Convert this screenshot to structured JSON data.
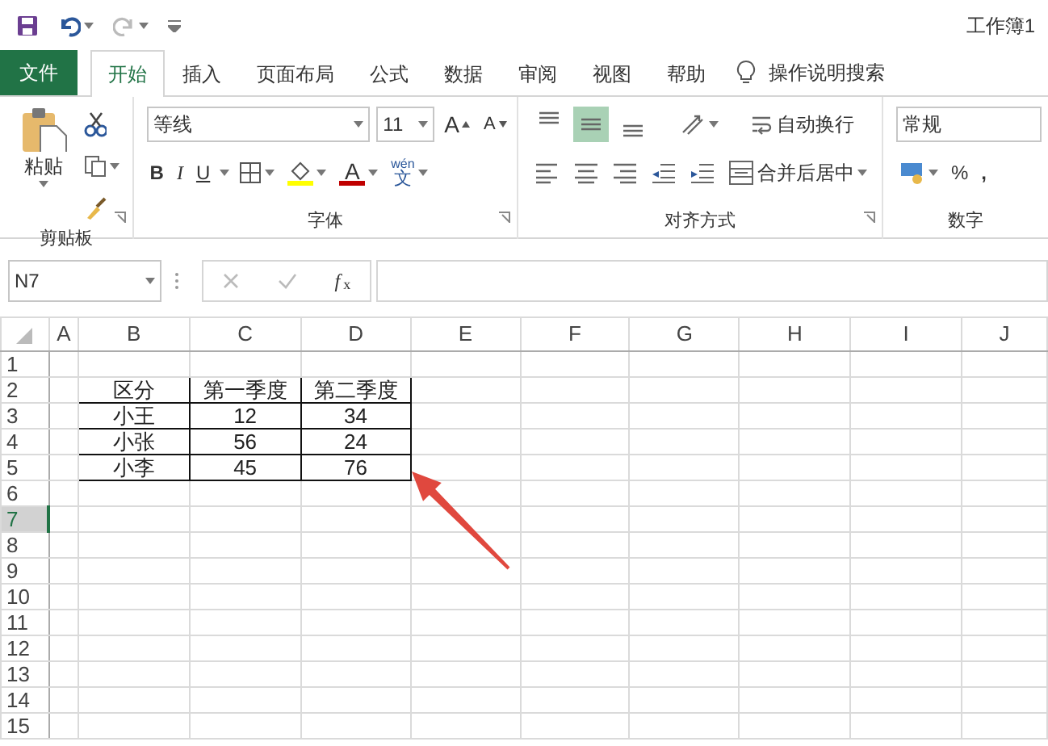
{
  "window": {
    "title": "工作簿1"
  },
  "file_tab": "文件",
  "tabs": [
    {
      "label": "开始",
      "selected": true
    },
    {
      "label": "插入",
      "selected": false
    },
    {
      "label": "页面布局",
      "selected": false
    },
    {
      "label": "公式",
      "selected": false
    },
    {
      "label": "数据",
      "selected": false
    },
    {
      "label": "审阅",
      "selected": false
    },
    {
      "label": "视图",
      "selected": false
    },
    {
      "label": "帮助",
      "selected": false
    }
  ],
  "tell_me": "操作说明搜索",
  "ribbon": {
    "clipboard": {
      "label": "剪贴板",
      "paste": "粘贴"
    },
    "font": {
      "label": "字体",
      "font_name": "等线",
      "font_size": "11",
      "grow": "A",
      "shrink": "A",
      "bold": "B",
      "italic": "I",
      "underline": "U",
      "font_color": "A",
      "phonetic_top": "wén",
      "phonetic_bottom": "文"
    },
    "alignment": {
      "label": "对齐方式",
      "vertical": [
        {
          "kind": "top",
          "selected": false
        },
        {
          "kind": "middle",
          "selected": true
        },
        {
          "kind": "bottom",
          "selected": false
        }
      ],
      "wrap_text": "自动换行",
      "merge_center": "合并后居中"
    },
    "number": {
      "label": "数字",
      "format": "常规",
      "percent": "%",
      "comma": ","
    }
  },
  "formula_bar": {
    "name_box": "N7",
    "fx": "*f*$_{x}$"
  },
  "sheet": {
    "columns": [
      "A",
      "B",
      "C",
      "D",
      "E",
      "F",
      "G",
      "H",
      "I",
      "J"
    ],
    "rows": [
      {
        "label": "1",
        "selected": false
      },
      {
        "label": "2",
        "selected": false
      },
      {
        "label": "3",
        "selected": false
      },
      {
        "label": "4",
        "selected": false
      },
      {
        "label": "5",
        "selected": false
      },
      {
        "label": "6",
        "selected": false
      },
      {
        "label": "7",
        "selected": true
      },
      {
        "label": "8",
        "selected": false
      },
      {
        "label": "9",
        "selected": false
      },
      {
        "label": "10",
        "selected": false
      },
      {
        "label": "11",
        "selected": false
      },
      {
        "label": "12",
        "selected": false
      },
      {
        "label": "13",
        "selected": false
      },
      {
        "label": "14",
        "selected": false
      },
      {
        "label": "15",
        "selected": false
      }
    ],
    "table": [
      [
        "区分",
        "第一季度",
        "第二季度"
      ],
      [
        "小王",
        "12",
        "34"
      ],
      [
        "小张",
        "56",
        "24"
      ],
      [
        "小李",
        "45",
        "76"
      ]
    ]
  },
  "annotation": {
    "kind": "arrow"
  }
}
